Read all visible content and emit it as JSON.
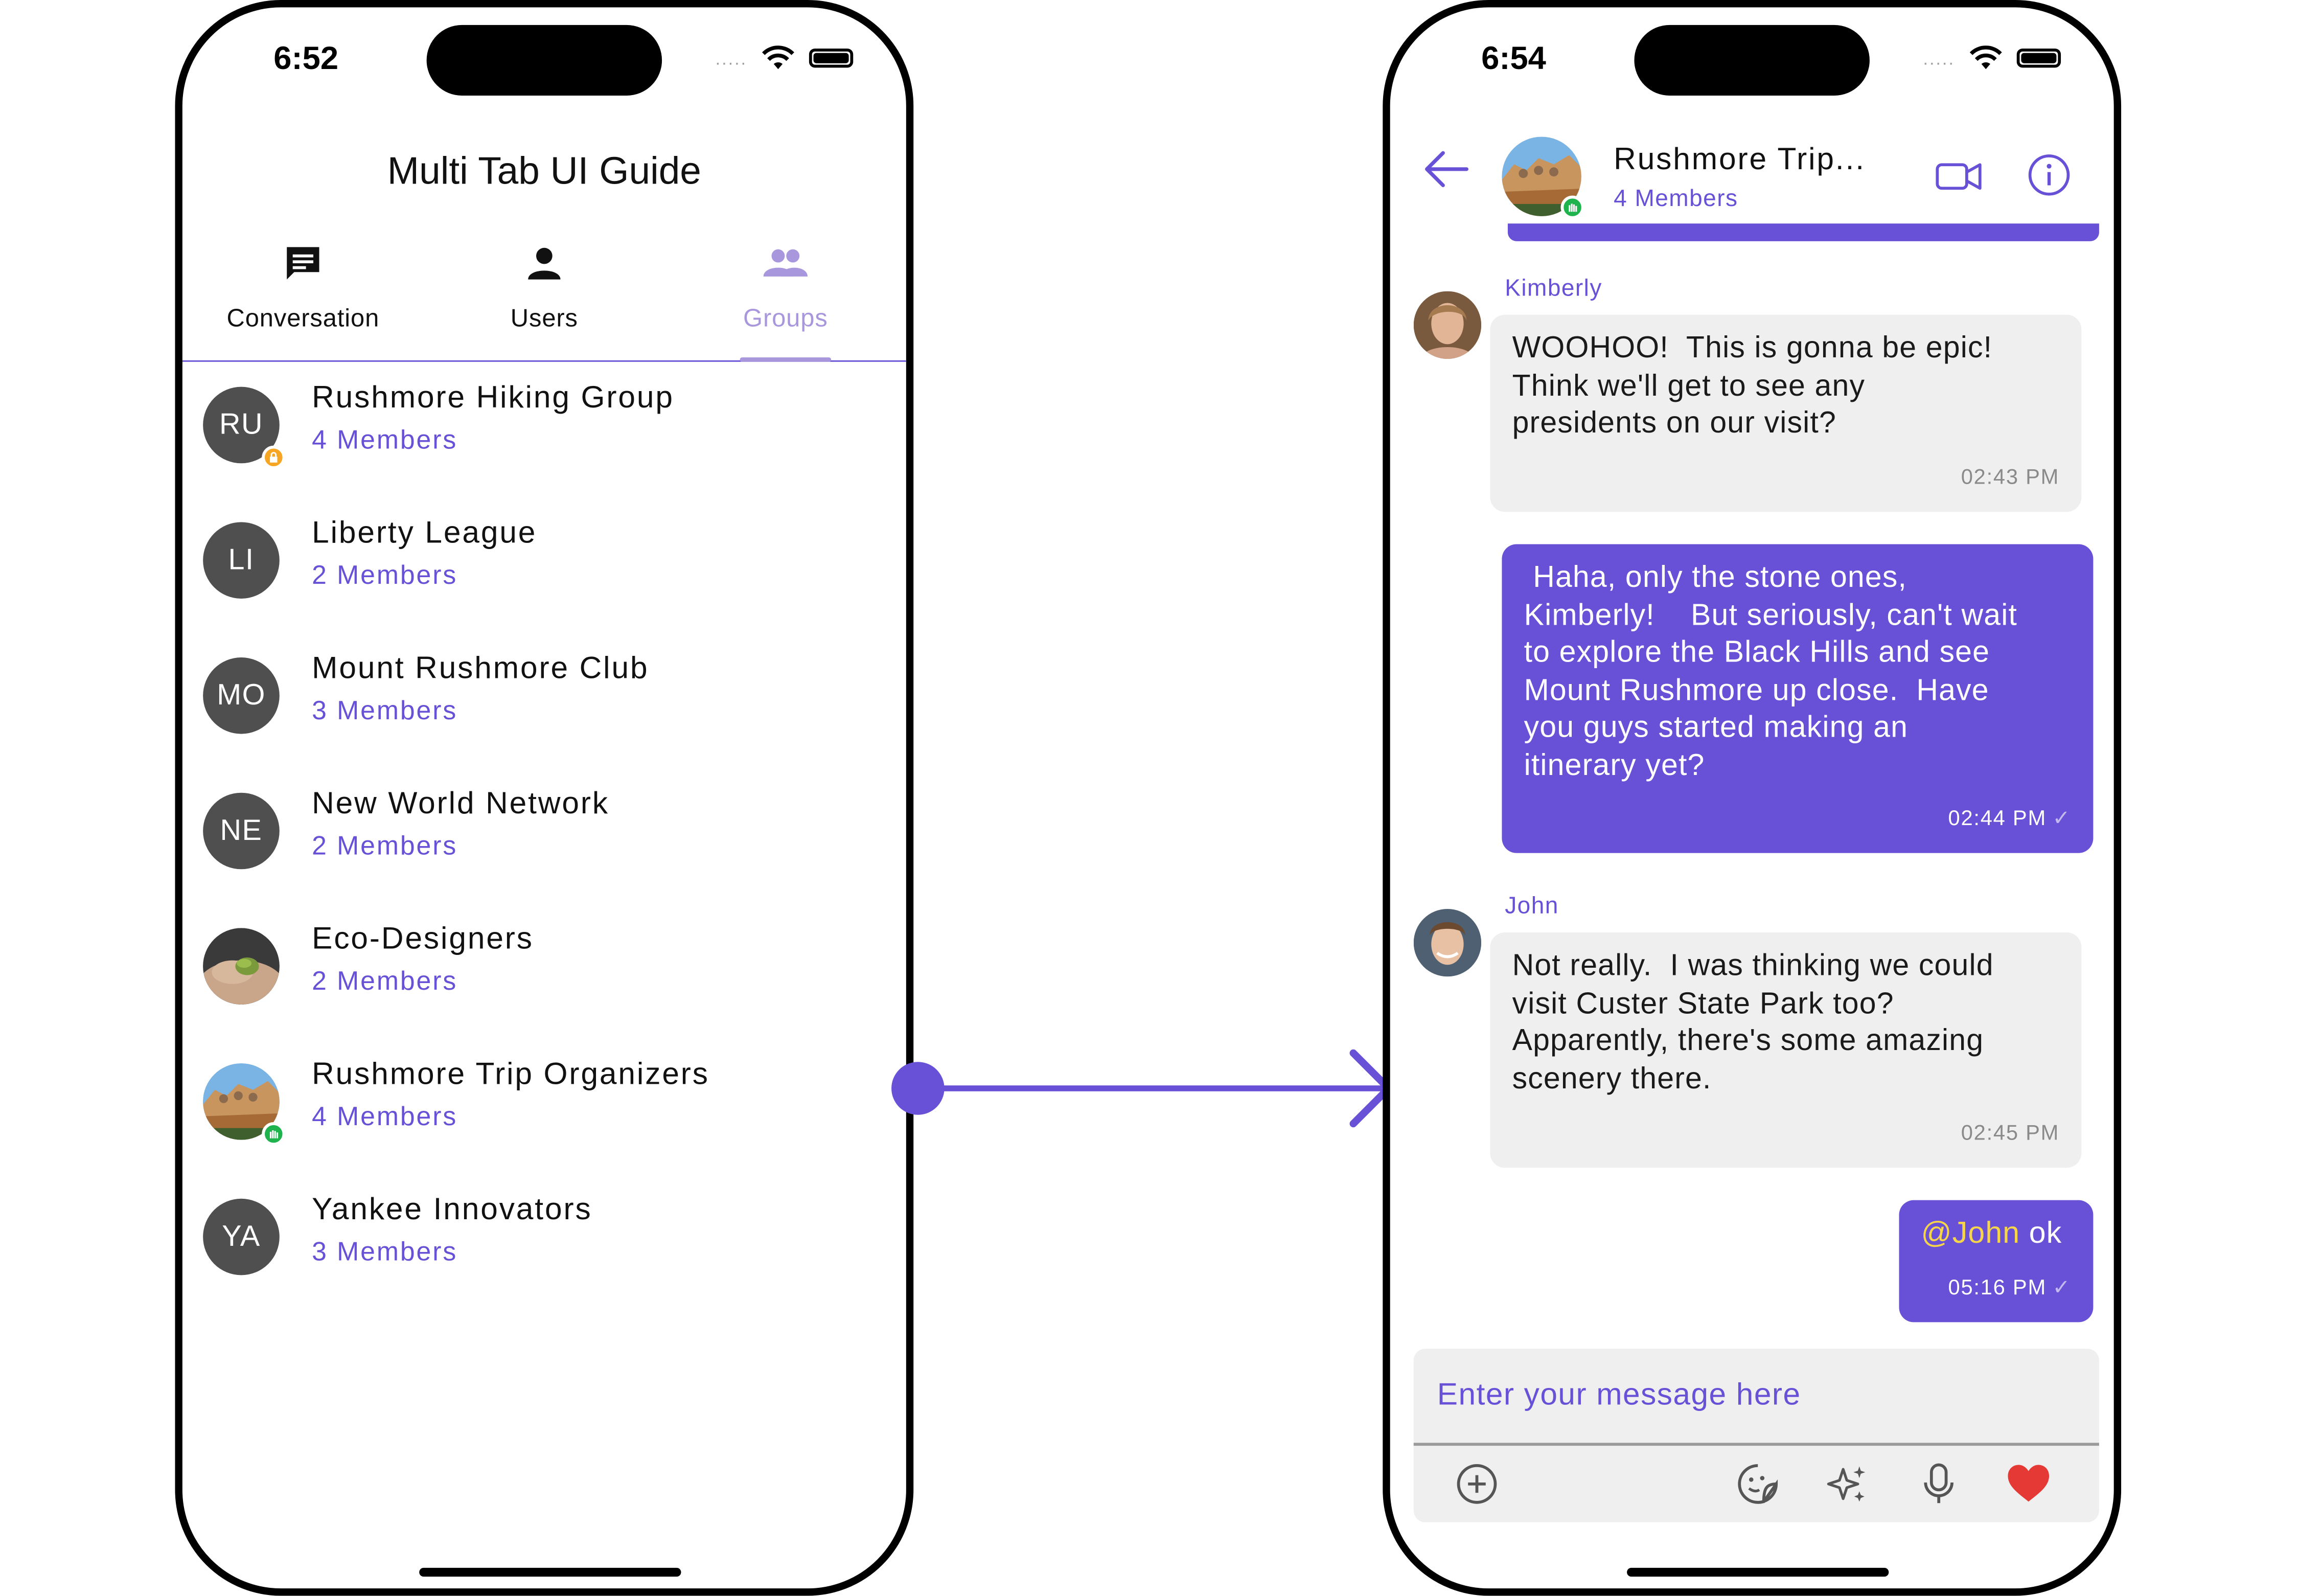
{
  "left_phone": {
    "status": {
      "time": "6:52",
      "signal": "....."
    },
    "page_title": "Multi Tab UI Guide",
    "tabs": [
      {
        "label": "Conversation",
        "icon": "chat-icon",
        "active": false
      },
      {
        "label": "Users",
        "icon": "user-icon",
        "active": false
      },
      {
        "label": "Groups",
        "icon": "group-icon",
        "active": true
      }
    ],
    "groups": [
      {
        "initials": "RU",
        "name": "Rushmore Hiking Group",
        "members": "4 Members",
        "badge": "lock-icon"
      },
      {
        "initials": "LI",
        "name": "Liberty League",
        "members": "2 Members"
      },
      {
        "initials": "MO",
        "name": "Mount Rushmore Club",
        "members": "3 Members"
      },
      {
        "initials": "NE",
        "name": "New World Network",
        "members": "2 Members"
      },
      {
        "initials": "",
        "name": "Eco-Designers",
        "members": "2 Members",
        "avatar": "leaf-hands-photo"
      },
      {
        "initials": "",
        "name": "Rushmore Trip Organizers",
        "members": "4 Members",
        "avatar": "mount-rushmore-photo",
        "badge": "hand-icon"
      },
      {
        "initials": "YA",
        "name": "Yankee Innovators",
        "members": "3 Members"
      }
    ]
  },
  "right_phone": {
    "status": {
      "time": "6:54",
      "signal": "....."
    },
    "header": {
      "title": "Rushmore Trip...",
      "subtitle": "4 Members"
    },
    "messages": [
      {
        "sender": "Kimberly",
        "text": "WOOHOO!  This is gonna be epic!\nThink we'll get to see any\npresidents on our visit?",
        "time": "02:43 PM",
        "outgoing": false
      },
      {
        "sender": "",
        "text": " Haha, only the stone ones,\nKimberly!    But seriously, can't wait\nto explore the Black Hills and see\nMount Rushmore up close.  Have\nyou guys started making an\nitinerary yet?",
        "time": "02:44 PM",
        "outgoing": true
      },
      {
        "sender": "John",
        "text": "Not really.  I was thinking we could\nvisit Custer State Park too?\nApparently, there's some amazing\nscenery there.",
        "time": "02:45 PM",
        "outgoing": false
      },
      {
        "sender": "",
        "mention": "@John",
        "text": " ok",
        "time": "05:16 PM",
        "outgoing": true
      }
    ],
    "composer": {
      "placeholder": "Enter your message here"
    }
  },
  "colors": {
    "accent": "#6851d6",
    "accent_light": "#a897dd",
    "avatar_gray": "#4f4f4f",
    "bubble_incoming": "#efefef",
    "mention": "#f6d54a",
    "online_green": "#1fb34d",
    "lock_orange": "#f6a623",
    "heart_red": "#e53935"
  }
}
